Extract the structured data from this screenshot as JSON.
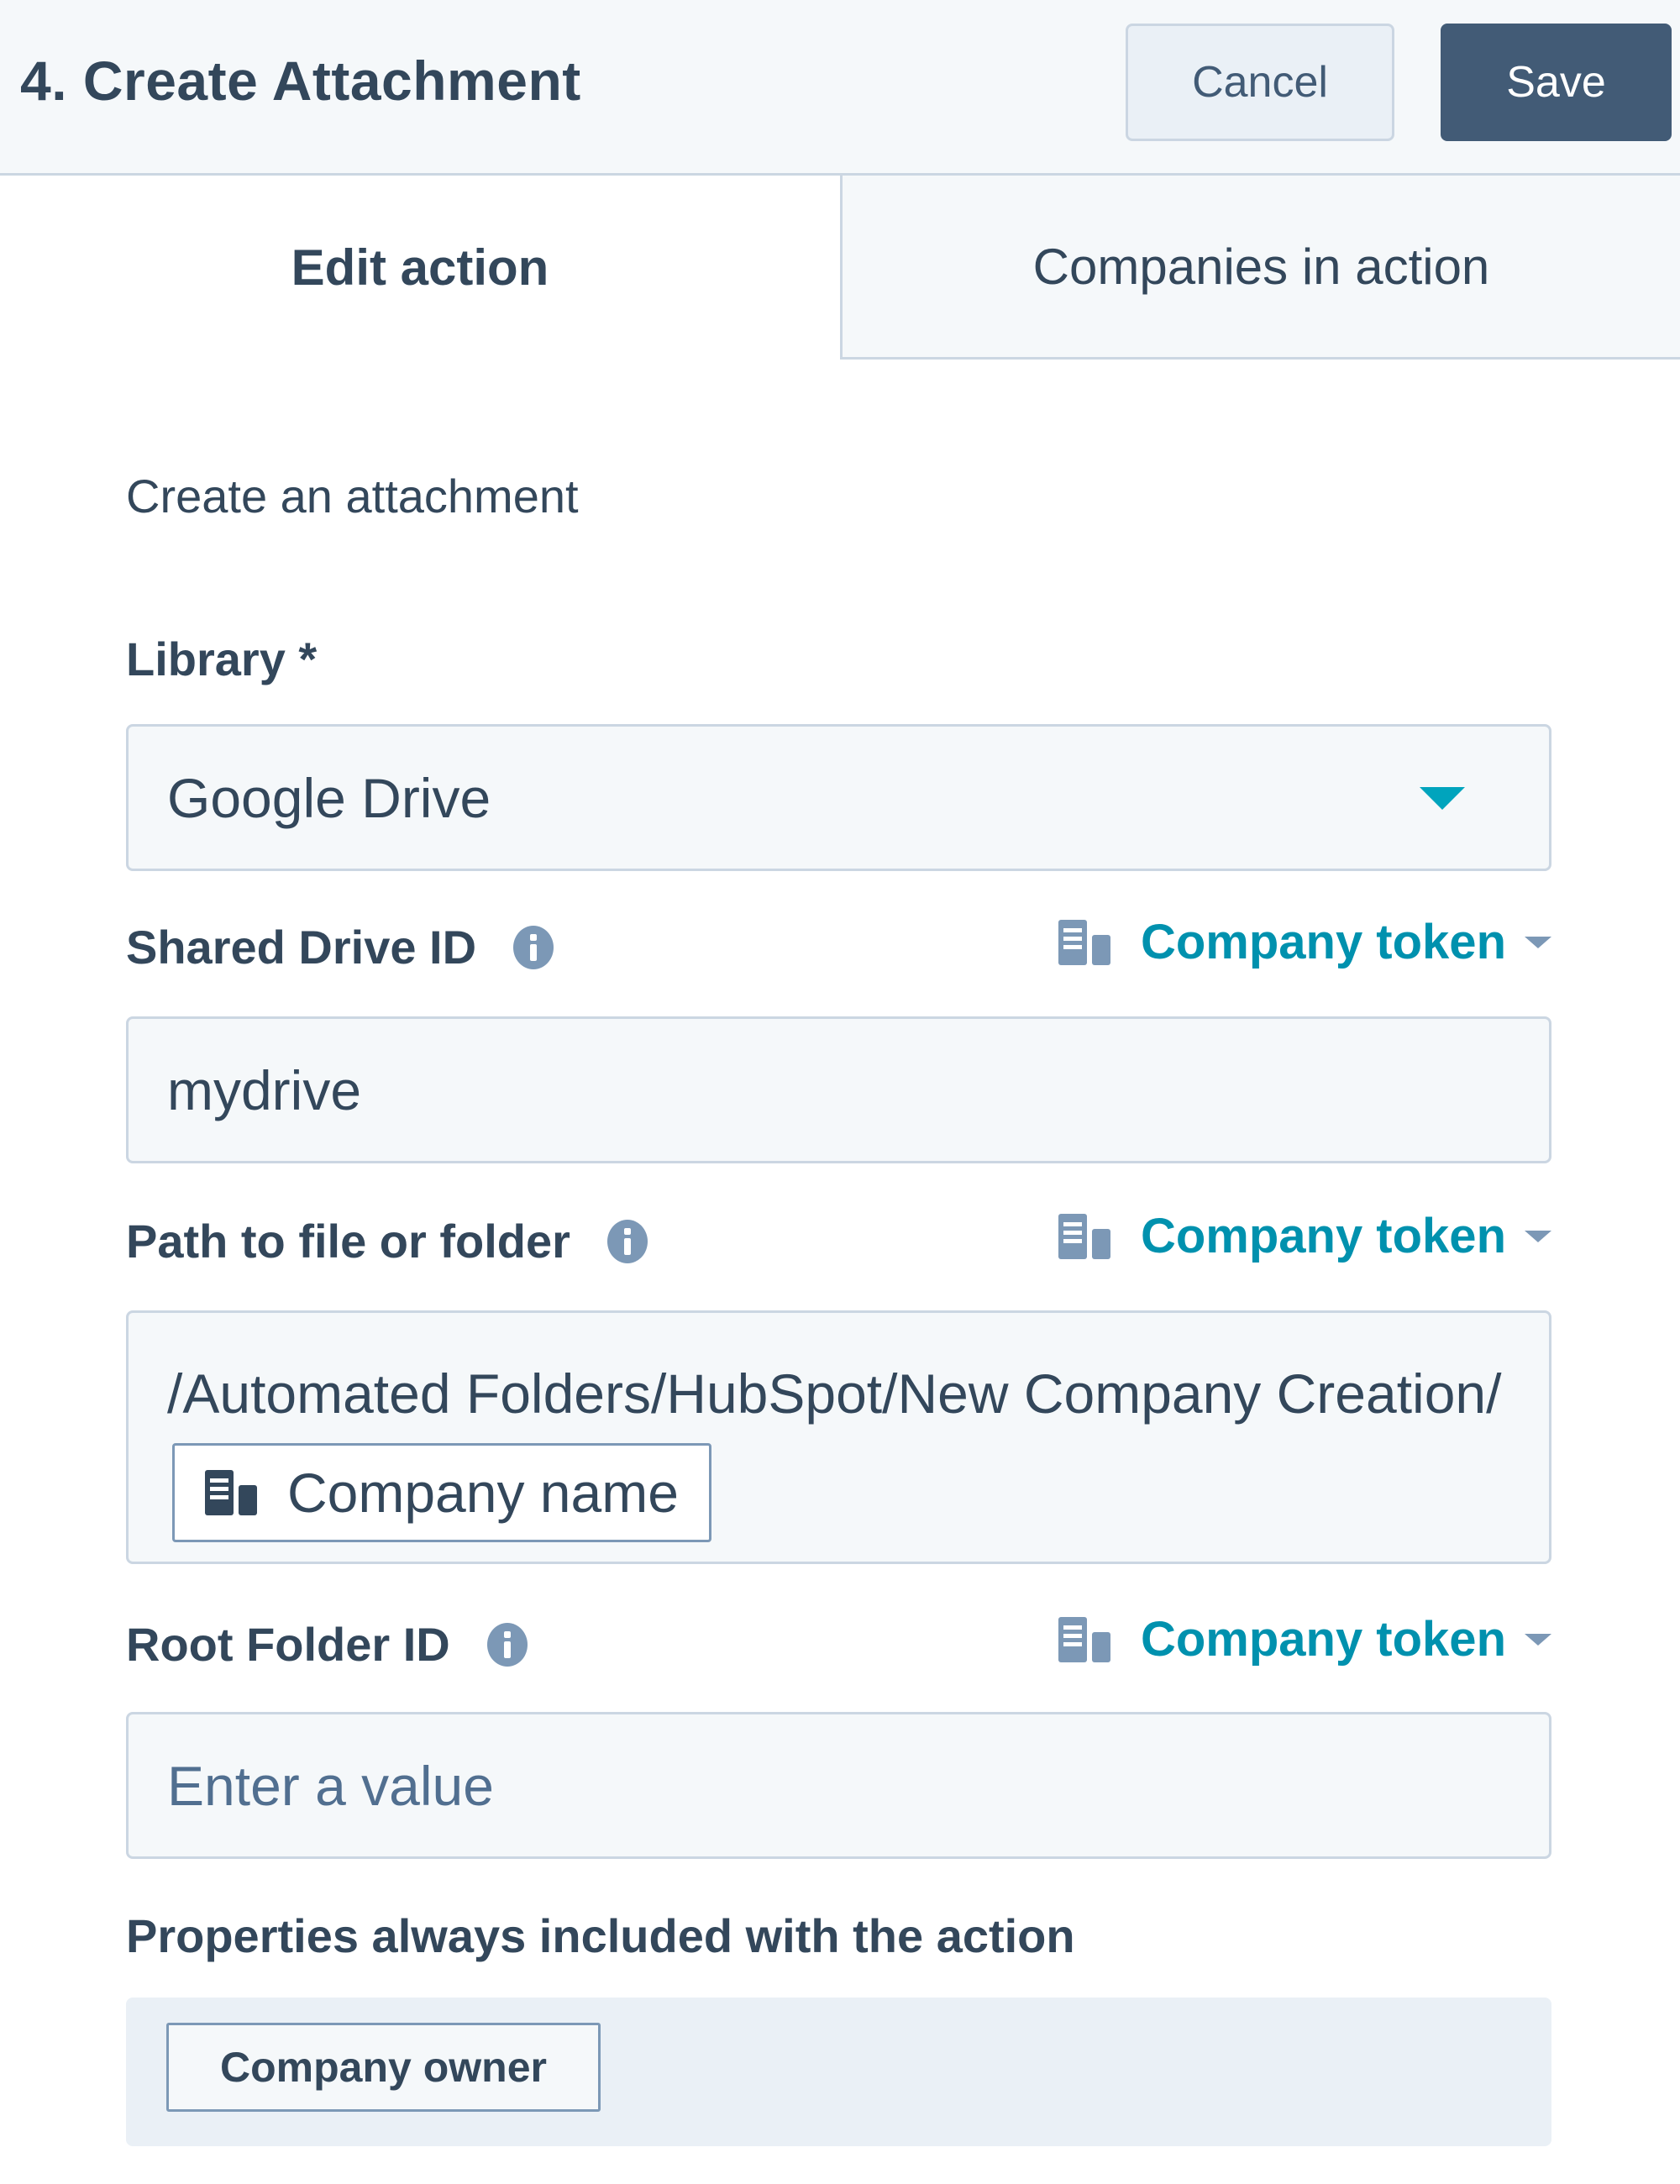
{
  "header": {
    "title": "4. Create Attachment",
    "cancel_label": "Cancel",
    "save_label": "Save"
  },
  "tabs": [
    {
      "label": "Edit action",
      "active": true
    },
    {
      "label": "Companies in action",
      "active": false
    }
  ],
  "form": {
    "description": "Create an attachment",
    "library": {
      "label": "Library *",
      "value": "Google Drive"
    },
    "shared_drive_id": {
      "label": "Shared Drive ID",
      "token_label": "Company token",
      "value": "mydrive"
    },
    "path": {
      "label": "Path to file or folder",
      "token_label": "Company token",
      "value_text": "/Automated Folders/HubSpot/New Company Creation/",
      "token_chip": "Company name"
    },
    "root_folder_id": {
      "label": "Root Folder ID",
      "token_label": "Company token",
      "placeholder": "Enter a value"
    },
    "properties": {
      "label": "Properties always included with the action",
      "items": [
        "Company owner"
      ]
    }
  },
  "colors": {
    "accent": "#0091ae",
    "primary_button": "#425b76",
    "text": "#33475b"
  }
}
